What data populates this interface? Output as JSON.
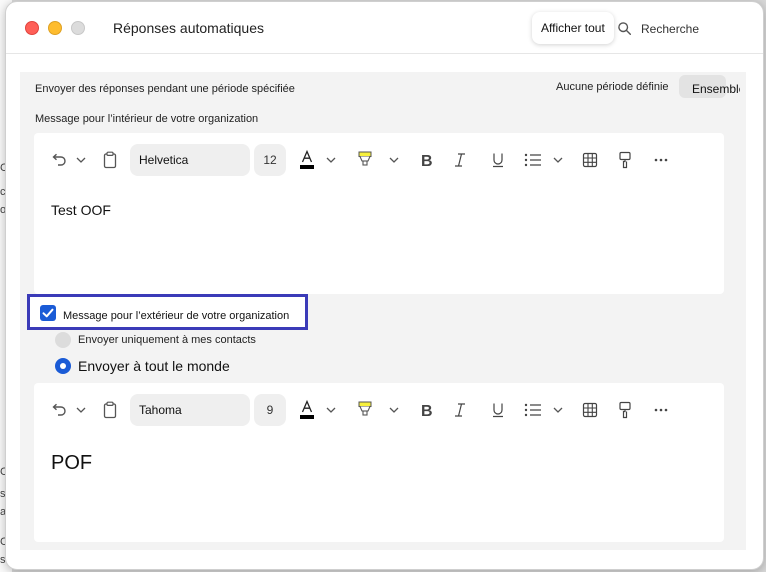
{
  "window": {
    "title": "Réponses automatiques",
    "show_all": "Afficher tout",
    "search_placeholder": "Recherche"
  },
  "period": {
    "label": "Envoyer des réponses pendant une période spécifiée",
    "value": "Aucune période définie",
    "button": "Ensemble"
  },
  "inside": {
    "label": "Message pour l’intérieur de votre organization",
    "font": "Helvetica",
    "size": "12",
    "body": "Test OOF"
  },
  "outside": {
    "label": "Message pour l’extérieur de votre organization",
    "checked": true,
    "radio_contacts": "Envoyer uniquement à mes contacts",
    "radio_everyone": "Envoyer à tout le monde",
    "selected": "Envoyer à tout le monde",
    "font": "Tahoma",
    "size": "9",
    "body": "POF"
  },
  "background_fragments": [
    "C",
    "c",
    "o",
    "C",
    "s",
    "a",
    "C",
    "s."
  ],
  "colors": {
    "accent": "#1a5bd6",
    "focus_border": "#3b3bb8",
    "highlight": "#f6f03c"
  }
}
